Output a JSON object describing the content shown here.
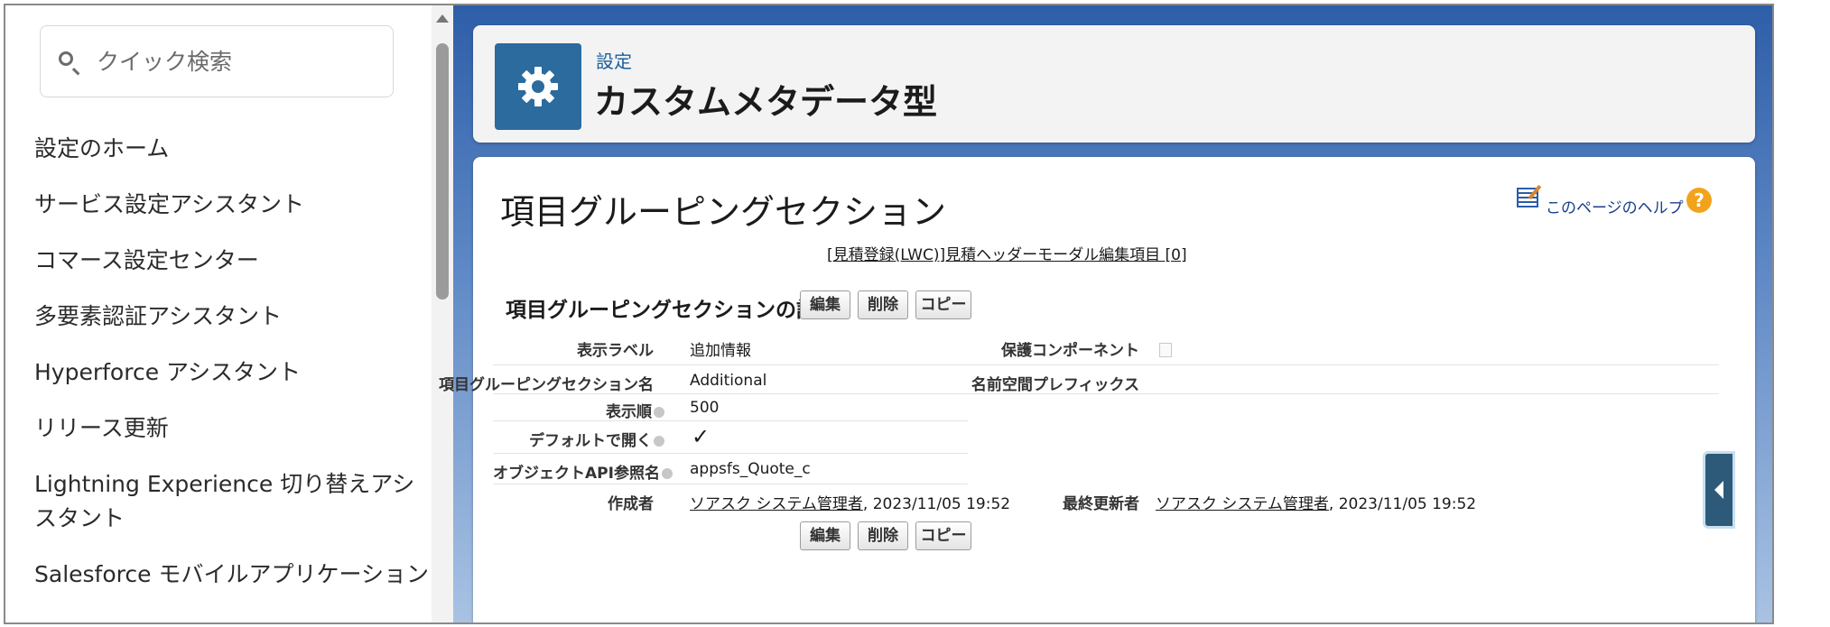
{
  "sidebar": {
    "search_placeholder": "クイック検索",
    "items": [
      {
        "label": "設定のホーム"
      },
      {
        "label": "サービス設定アシスタント"
      },
      {
        "label": "コマース設定センター"
      },
      {
        "label": "多要素認証アシスタント"
      },
      {
        "label": "Hyperforce アシスタント"
      },
      {
        "label": "リリース更新"
      },
      {
        "label": "Lightning Experience 切り替えアシスタント"
      },
      {
        "label": "Salesforce モバイルアプリケーション"
      }
    ]
  },
  "header": {
    "breadcrumb": "設定",
    "title": "カスタムメタデータ型"
  },
  "content": {
    "page_title": "項目グルーピングセクション",
    "help_label": "このページのヘルプ",
    "related_link": "[見積登録(LWC)]見積ヘッダーモーダル編集項目 [0]",
    "section_title": "項目グルーピングセクションの詳細",
    "buttons": {
      "edit": "編集",
      "delete": "削除",
      "copy": "コピー"
    },
    "fields": {
      "display_label": {
        "label": "表示ラベル",
        "value": "追加情報"
      },
      "protected_component": {
        "label": "保護コンポーネント"
      },
      "group_section_name": {
        "label": "項目グルーピングセクション名",
        "value": "Additional"
      },
      "namespace_prefix": {
        "label": "名前空間プレフィックス"
      },
      "display_order": {
        "label": "表示順",
        "value": "500"
      },
      "open_by_default": {
        "label": "デフォルトで開く",
        "value": "✓"
      },
      "object_api_ref": {
        "label": "オブジェクトAPI参照名",
        "value": "appsfs_Quote_c"
      },
      "created_by": {
        "label": "作成者",
        "user": "ソアスク システム管理者",
        "date": ", 2023/11/05 19:52"
      },
      "modified_by": {
        "label": "最終更新者",
        "user": "ソアスク システム管理者",
        "date": ", 2023/11/05 19:52"
      }
    }
  },
  "colors": {
    "accent": "#2b6b9e",
    "link": "#1a5f9c",
    "help_icon": "#f2a31c"
  }
}
